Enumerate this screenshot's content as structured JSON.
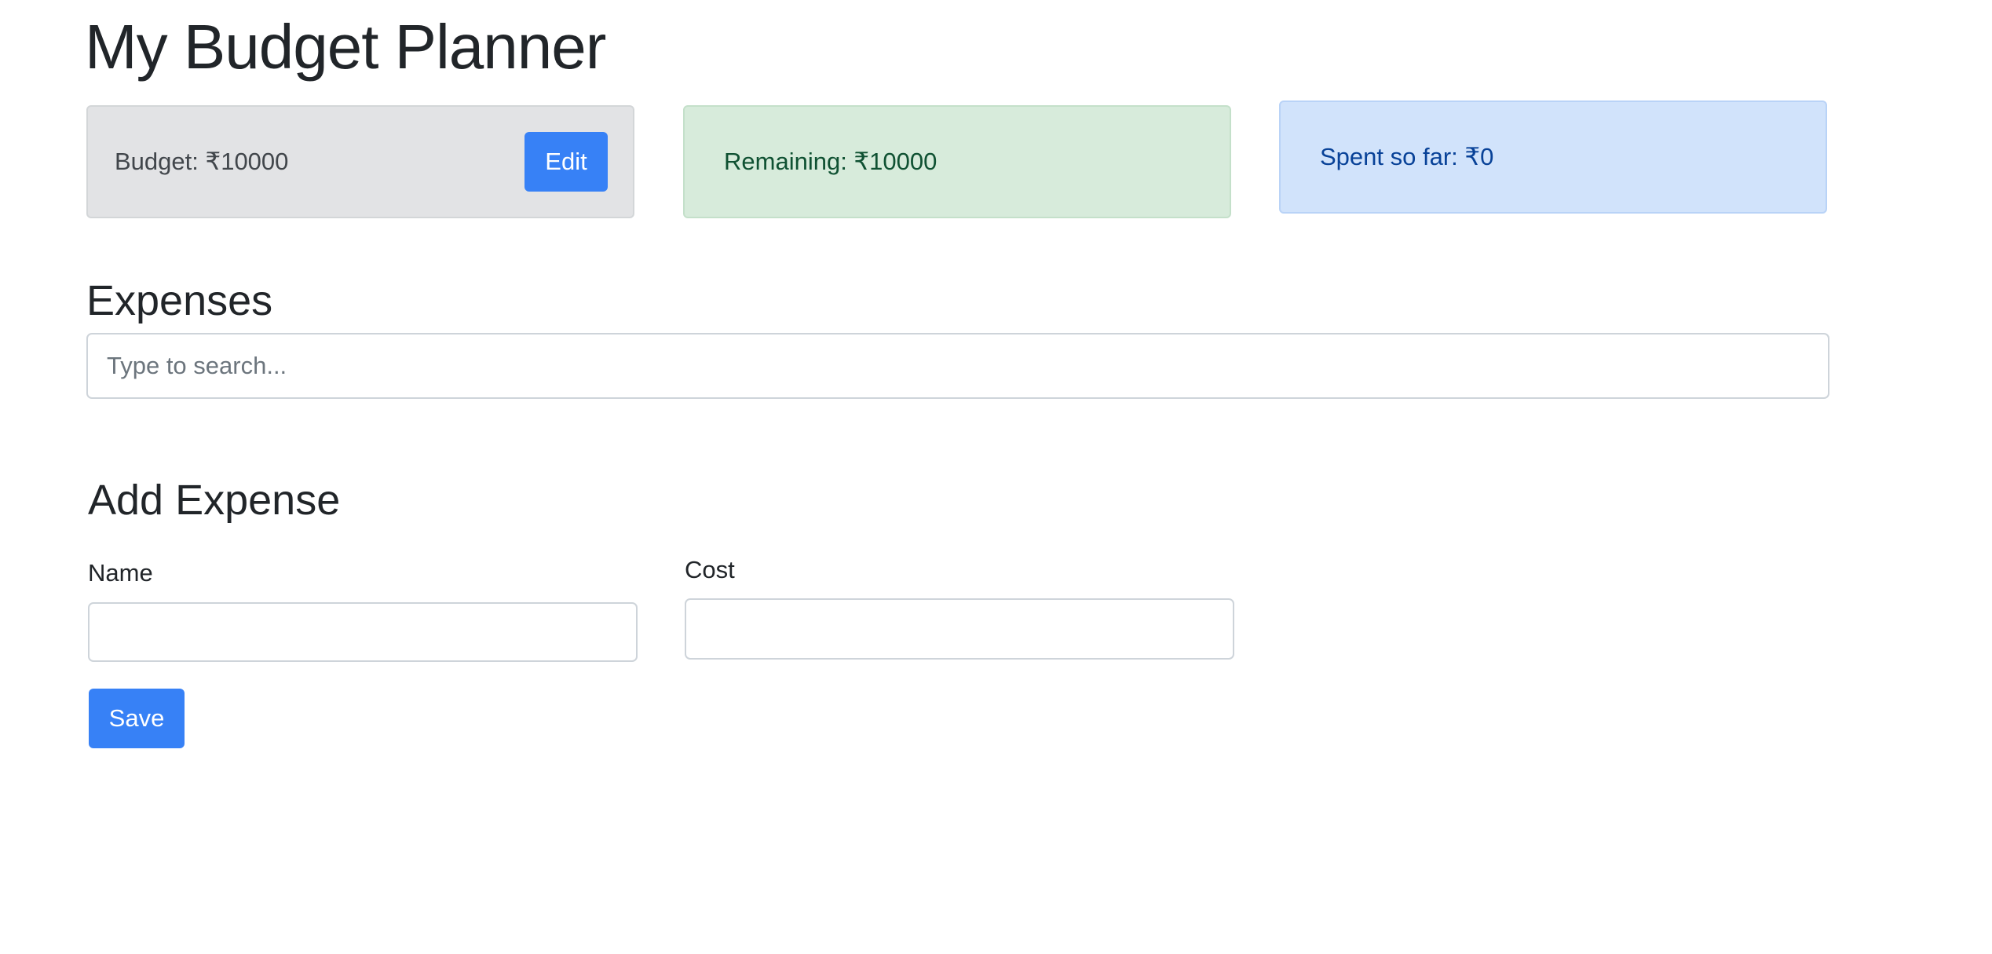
{
  "header": {
    "title": "My Budget Planner"
  },
  "summary": {
    "budget_label": "Budget: ₹10000",
    "edit_label": "Edit",
    "remaining_label": "Remaining: ₹10000",
    "spent_label": "Spent so far: ₹0"
  },
  "expenses": {
    "heading": "Expenses",
    "search_placeholder": "Type to search...",
    "search_value": ""
  },
  "add_expense": {
    "heading": "Add Expense",
    "name_label": "Name",
    "name_value": "",
    "cost_label": "Cost",
    "cost_value": "",
    "save_label": "Save"
  },
  "colors": {
    "primary": "#3781f6",
    "secondary_bg": "#e2e3e5",
    "success_bg": "#d7ebdb",
    "info_bg": "#d1e3fb"
  }
}
